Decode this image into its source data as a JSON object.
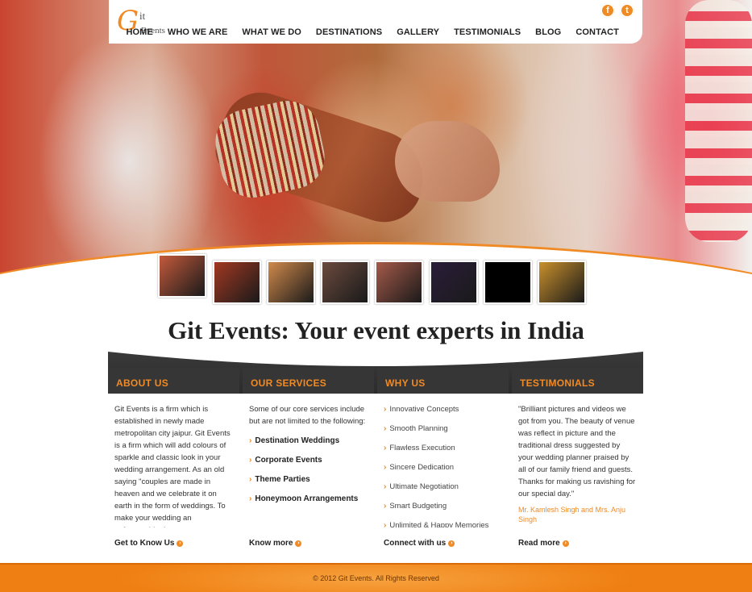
{
  "header": {
    "logo": {
      "g": "G",
      "it": "it",
      "events": "Events"
    },
    "nav": [
      "HOME",
      "WHO WE ARE",
      "WHAT WE DO",
      "DESTINATIONS",
      "GALLERY",
      "TESTIMONIALS",
      "BLOG",
      "CONTACT"
    ],
    "social": {
      "facebook": "f",
      "twitter": "t"
    }
  },
  "hero": {
    "thumbnails": [
      "wedding-hands",
      "hall-decor",
      "stage-lights",
      "ceremony",
      "pink-decor",
      "mandap",
      "black",
      "floral-arch"
    ],
    "thumb_colors": [
      "#c45a3c",
      "#a13822",
      "#d18a4c",
      "#6b4a3e",
      "#a55a4a",
      "#2a1d3a",
      "#000000",
      "#c9902c"
    ]
  },
  "tagline": "Git Events: Your event experts in India",
  "columns": {
    "about": {
      "title": "ABOUT US",
      "text": "Git Events is a firm which is established in newly made metropolitan city jaipur. Git Events is a firm which will add colours of sparkle and classic look in your wedding arrangement. As an old saying \"couples are made in heaven and we celebrate it on earth in the form of weddings. To make your wedding an unforgettable day or",
      "more": "Get to Know Us"
    },
    "services": {
      "title": "OUR SERVICES",
      "intro": "Some of our core services include but are not limited to the following:",
      "items": [
        "Destination Weddings",
        "Corporate Events",
        "Theme Parties",
        "Honeymoon Arrangements"
      ],
      "more": "Know more"
    },
    "why": {
      "title": "WHY US",
      "items": [
        "Innovative Concepts",
        "Smooth Planning",
        "Flawless Execution",
        "Sincere Dedication",
        "Ultimate Negotiation",
        "Smart Budgeting",
        "Unlimited & Happy Memories"
      ],
      "more": "Connect with us"
    },
    "testimonials": {
      "title": "TESTIMONIALS",
      "quote": "\"Brilliant pictures and videos we got from you. The beauty of venue was reflect in picture and the traditional dress suggested by your wedding planner praised by all of our family friend and guests. Thanks for making us ravishing for our special day.\"",
      "author": "Mr. Kamlesh Singh and Mrs. Anju Singh",
      "more": "Read more"
    }
  },
  "footer": {
    "copyright": "© 2012 Git Events. All Rights Reserved"
  },
  "colors": {
    "accent": "#f08a24",
    "dark": "#363636"
  }
}
